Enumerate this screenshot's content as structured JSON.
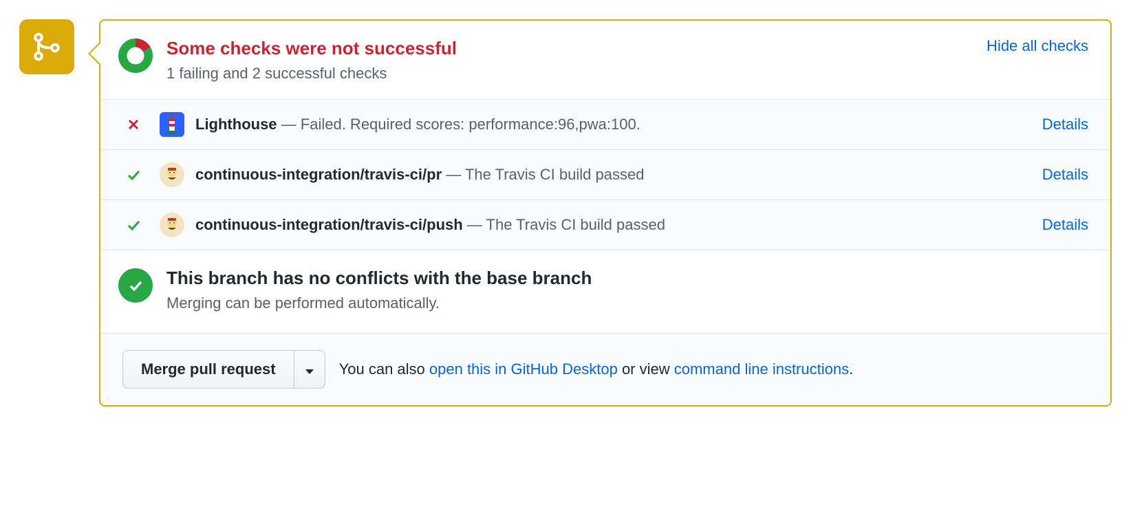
{
  "header": {
    "title": "Some checks were not successful",
    "subtitle": "1 failing and 2 successful checks",
    "hide_checks": "Hide all checks"
  },
  "checks": [
    {
      "status": "fail",
      "avatar": "lighthouse",
      "name": "Lighthouse",
      "sep": " — ",
      "message": "Failed. Required scores: performance:96,pwa:100.",
      "details": "Details"
    },
    {
      "status": "pass",
      "avatar": "travis",
      "name": "continuous-integration/travis-ci/pr",
      "sep": " — ",
      "message": "The Travis CI build passed",
      "details": "Details"
    },
    {
      "status": "pass",
      "avatar": "travis",
      "name": "continuous-integration/travis-ci/push",
      "sep": " — ",
      "message": "The Travis CI build passed",
      "details": "Details"
    }
  ],
  "conflicts": {
    "title": "This branch has no conflicts with the base branch",
    "subtitle": "Merging can be performed automatically."
  },
  "footer": {
    "merge_button": "Merge pull request",
    "prefix": "You can also ",
    "link_desktop": "open this in GitHub Desktop",
    "middle": " or view ",
    "link_cli": "command line instructions",
    "suffix": "."
  }
}
